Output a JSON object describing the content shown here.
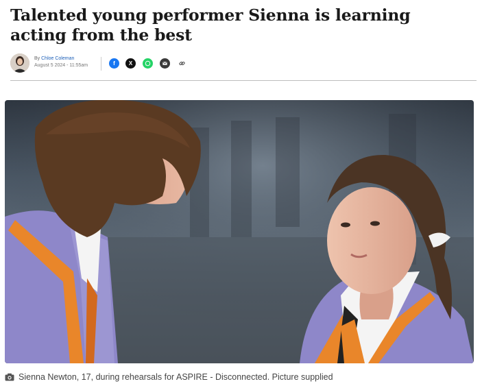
{
  "article": {
    "headline": "Talented young performer Sienna is learning acting from the best",
    "byline_prefix": "By",
    "author": "Chloe Coleman",
    "date": "August 5 2024 - 11:55am"
  },
  "share": [
    {
      "name": "facebook-icon",
      "glyph": "f"
    },
    {
      "name": "x-icon",
      "glyph": "X"
    },
    {
      "name": "whatsapp-icon",
      "glyph": ""
    },
    {
      "name": "email-icon",
      "glyph": ""
    },
    {
      "name": "link-icon",
      "glyph": ""
    }
  ],
  "caption": {
    "icon": "camera-icon",
    "text": "Sienna Newton, 17, during rehearsals for ASPIRE - Disconnected. Picture supplied"
  },
  "colors": {
    "facebook": "#1877f2",
    "x": "#111111",
    "whatsapp": "#25d366",
    "email": "#3a3a3a",
    "author_link": "#1c5fb8",
    "uniform": "#8e87c9",
    "uniform_trim": "#e9862a"
  }
}
